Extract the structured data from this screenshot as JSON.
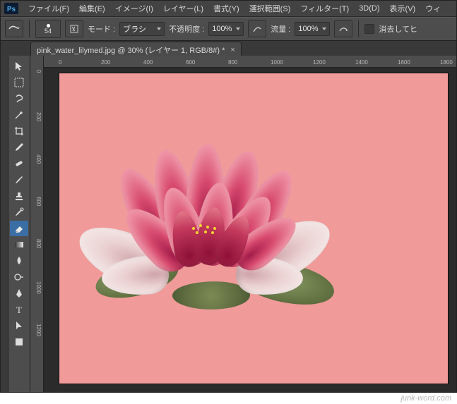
{
  "menu": {
    "items": [
      "ファイル(F)",
      "編集(E)",
      "イメージ(I)",
      "レイヤー(L)",
      "書式(Y)",
      "選択範囲(S)",
      "フィルター(T)",
      "3D(D)",
      "表示(V)",
      "ウィ"
    ]
  },
  "optbar": {
    "brush_size": "54",
    "mode_label": "モード :",
    "mode_value": "ブラシ",
    "opacity_label": "不透明度 :",
    "opacity_value": "100%",
    "flow_label": "流量 :",
    "flow_value": "100%",
    "erase_label": "消去してヒ"
  },
  "tab": {
    "title": "pink_water_lilymed.jpg @ 30% (レイヤー 1, RGB/8#) *"
  },
  "ruler_h": [
    "0",
    "200",
    "400",
    "600",
    "800",
    "1000",
    "1200",
    "1400",
    "1600",
    "1800"
  ],
  "ruler_v": [
    "0",
    "200",
    "400",
    "600",
    "800",
    "1000",
    "1200"
  ],
  "canvas": {
    "bg_color": "#f09a9a"
  },
  "watermark": "junk-word.com"
}
